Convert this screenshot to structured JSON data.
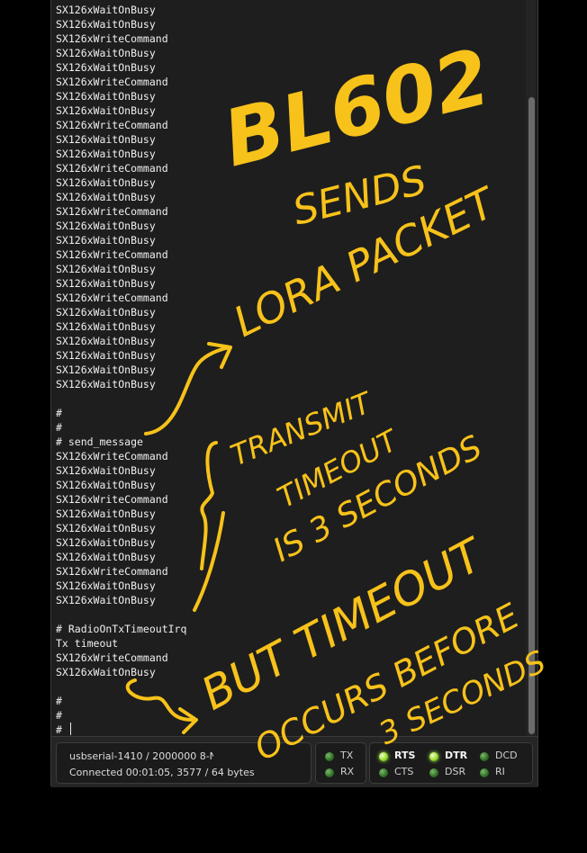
{
  "terminal": {
    "lines": [
      "SX126xWaitOnBusy",
      "SX126xWaitOnBusy",
      "SX126xWriteCommand",
      "SX126xWaitOnBusy",
      "SX126xWaitOnBusy",
      "SX126xWriteCommand",
      "SX126xWaitOnBusy",
      "SX126xWaitOnBusy",
      "SX126xWriteCommand",
      "SX126xWaitOnBusy",
      "SX126xWaitOnBusy",
      "SX126xWriteCommand",
      "SX126xWaitOnBusy",
      "SX126xWaitOnBusy",
      "SX126xWriteCommand",
      "SX126xWaitOnBusy",
      "SX126xWaitOnBusy",
      "SX126xWriteCommand",
      "SX126xWaitOnBusy",
      "SX126xWaitOnBusy",
      "SX126xWriteCommand",
      "SX126xWaitOnBusy",
      "SX126xWaitOnBusy",
      "SX126xWaitOnBusy",
      "SX126xWaitOnBusy",
      "SX126xWaitOnBusy",
      "SX126xWaitOnBusy",
      "",
      "#",
      "#",
      "# send_message",
      "SX126xWriteCommand",
      "SX126xWaitOnBusy",
      "SX126xWaitOnBusy",
      "SX126xWriteCommand",
      "SX126xWaitOnBusy",
      "SX126xWaitOnBusy",
      "SX126xWaitOnBusy",
      "SX126xWaitOnBusy",
      "SX126xWriteCommand",
      "SX126xWaitOnBusy",
      "SX126xWaitOnBusy",
      "",
      "# RadioOnTxTimeoutIrq",
      "Tx timeout",
      "SX126xWriteCommand",
      "SX126xWaitOnBusy",
      "",
      "#",
      "#",
      "# "
    ]
  },
  "status": {
    "port_info": "usbserial-1410 / 2000000 8-N",
    "connection": "Connected 00:01:05, 3577 / 64 bytes"
  },
  "indicators": {
    "tx": {
      "label": "TX",
      "on": false
    },
    "rx": {
      "label": "RX",
      "on": false
    },
    "rts": {
      "label": "RTS",
      "on": true
    },
    "cts": {
      "label": "CTS",
      "on": false
    },
    "dtr": {
      "label": "DTR",
      "on": true
    },
    "dsr": {
      "label": "DSR",
      "on": false
    },
    "dcd": {
      "label": "DCD",
      "on": false
    },
    "ri": {
      "label": "RI",
      "on": false
    }
  },
  "handwriting": {
    "line1": "BL602",
    "line2": "SENDS",
    "line3": "LORA PACKET",
    "line4": "TRANSMIT",
    "line5": "TIMEOUT",
    "line6": "IS 3 SECONDS",
    "line7": "BUT TIMEOUT",
    "line8": "OCCURS BEFORE",
    "line9": "3 SECONDS",
    "color": "#f7c21a"
  }
}
